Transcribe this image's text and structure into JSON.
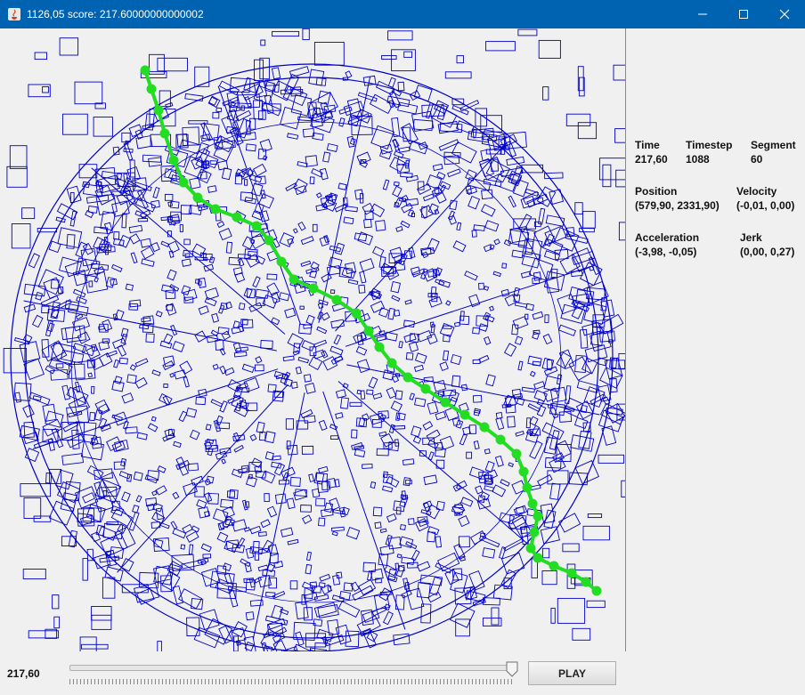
{
  "window": {
    "title": "1126,05 score: 217.60000000000002",
    "controls": [
      "minimize-icon",
      "maximize-icon",
      "close-icon"
    ]
  },
  "map": {
    "building_color": "#0000c8",
    "route_color": "#22dd22"
  },
  "info": {
    "time_label": "Time",
    "time_value": "217,60",
    "timestep_label": "Timestep",
    "timestep_value": "1088",
    "segment_label": "Segment",
    "segment_value": "60",
    "position_label": "Position",
    "position_value": "(579,90, 2331,90)",
    "velocity_label": "Velocity",
    "velocity_value": "(-0,01, 0,00)",
    "acceleration_label": "Acceleration",
    "acceleration_value": "(-3,98, -0,05)",
    "jerk_label": "Jerk",
    "jerk_value": "(0,00, 0,27)"
  },
  "playback": {
    "time_value": "217,60",
    "progress_fraction": 0.994,
    "play_label": "PLAY"
  }
}
